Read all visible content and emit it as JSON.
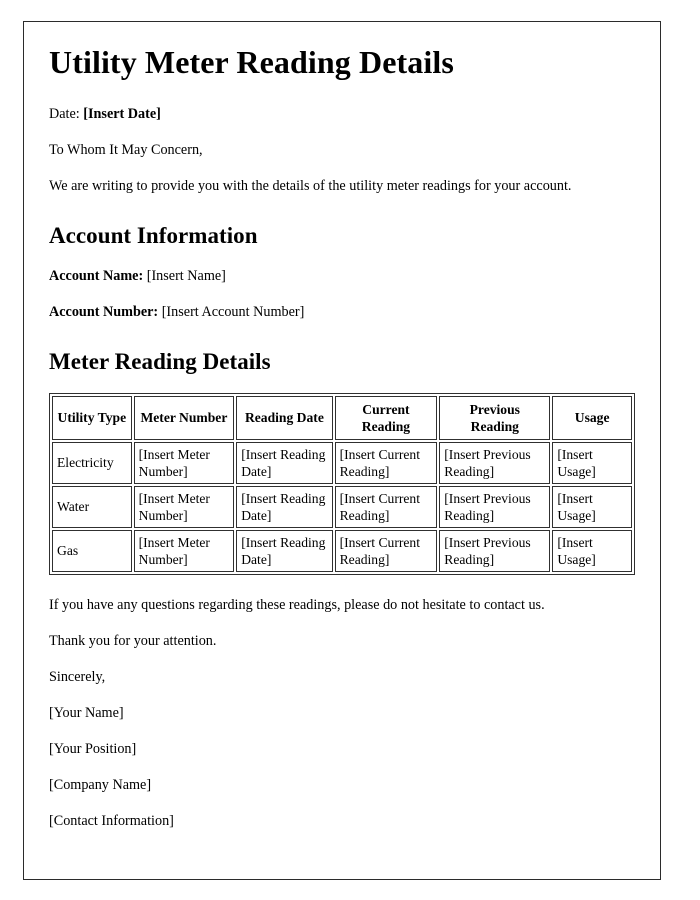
{
  "document": {
    "title": "Utility Meter Reading Details",
    "date_label": "Date:",
    "date_value": "[Insert Date]",
    "salutation": "To Whom It May Concern,",
    "intro_paragraph": "We are writing to provide you with the details of the utility meter readings for your account."
  },
  "account_information": {
    "heading": "Account Information",
    "fields": [
      {
        "label": "Account Name:",
        "value": "[Insert Name]"
      },
      {
        "label": "Account Number:",
        "value": "[Insert Account Number]"
      }
    ]
  },
  "meter_reading_details": {
    "heading": "Meter Reading Details",
    "table": {
      "columns": [
        "Utility Type",
        "Meter Number",
        "Reading Date",
        "Current Reading",
        "Previous Reading",
        "Usage"
      ],
      "rows": [
        {
          "utility_type": "Electricity",
          "meter_number": "[Insert Meter Number]",
          "reading_date": "[Insert Reading Date]",
          "current_reading": "[Insert Current Reading]",
          "previous_reading": "[Insert Previous Reading]",
          "usage": "[Insert Usage]"
        },
        {
          "utility_type": "Water",
          "meter_number": "[Insert Meter Number]",
          "reading_date": "[Insert Reading Date]",
          "current_reading": "[Insert Current Reading]",
          "previous_reading": "[Insert Previous Reading]",
          "usage": "[Insert Usage]"
        },
        {
          "utility_type": "Gas",
          "meter_number": "[Insert Meter Number]",
          "reading_date": "[Insert Reading Date]",
          "current_reading": "[Insert Current Reading]",
          "previous_reading": "[Insert Previous Reading]",
          "usage": "[Insert Usage]"
        }
      ]
    }
  },
  "closing": {
    "questions_paragraph": "If you have any questions regarding these readings, please do not hesitate to contact us.",
    "thanks_paragraph": "Thank you for your attention.",
    "sign_off": "Sincerely,",
    "signature_lines": [
      "[Your Name]",
      "[Your Position]",
      "[Company Name]",
      "[Contact Information]"
    ]
  },
  "colors": {
    "page_background": "#ffffff",
    "text": "#000000",
    "frame_border": "#2b2b2b",
    "table_border": "#303030"
  }
}
